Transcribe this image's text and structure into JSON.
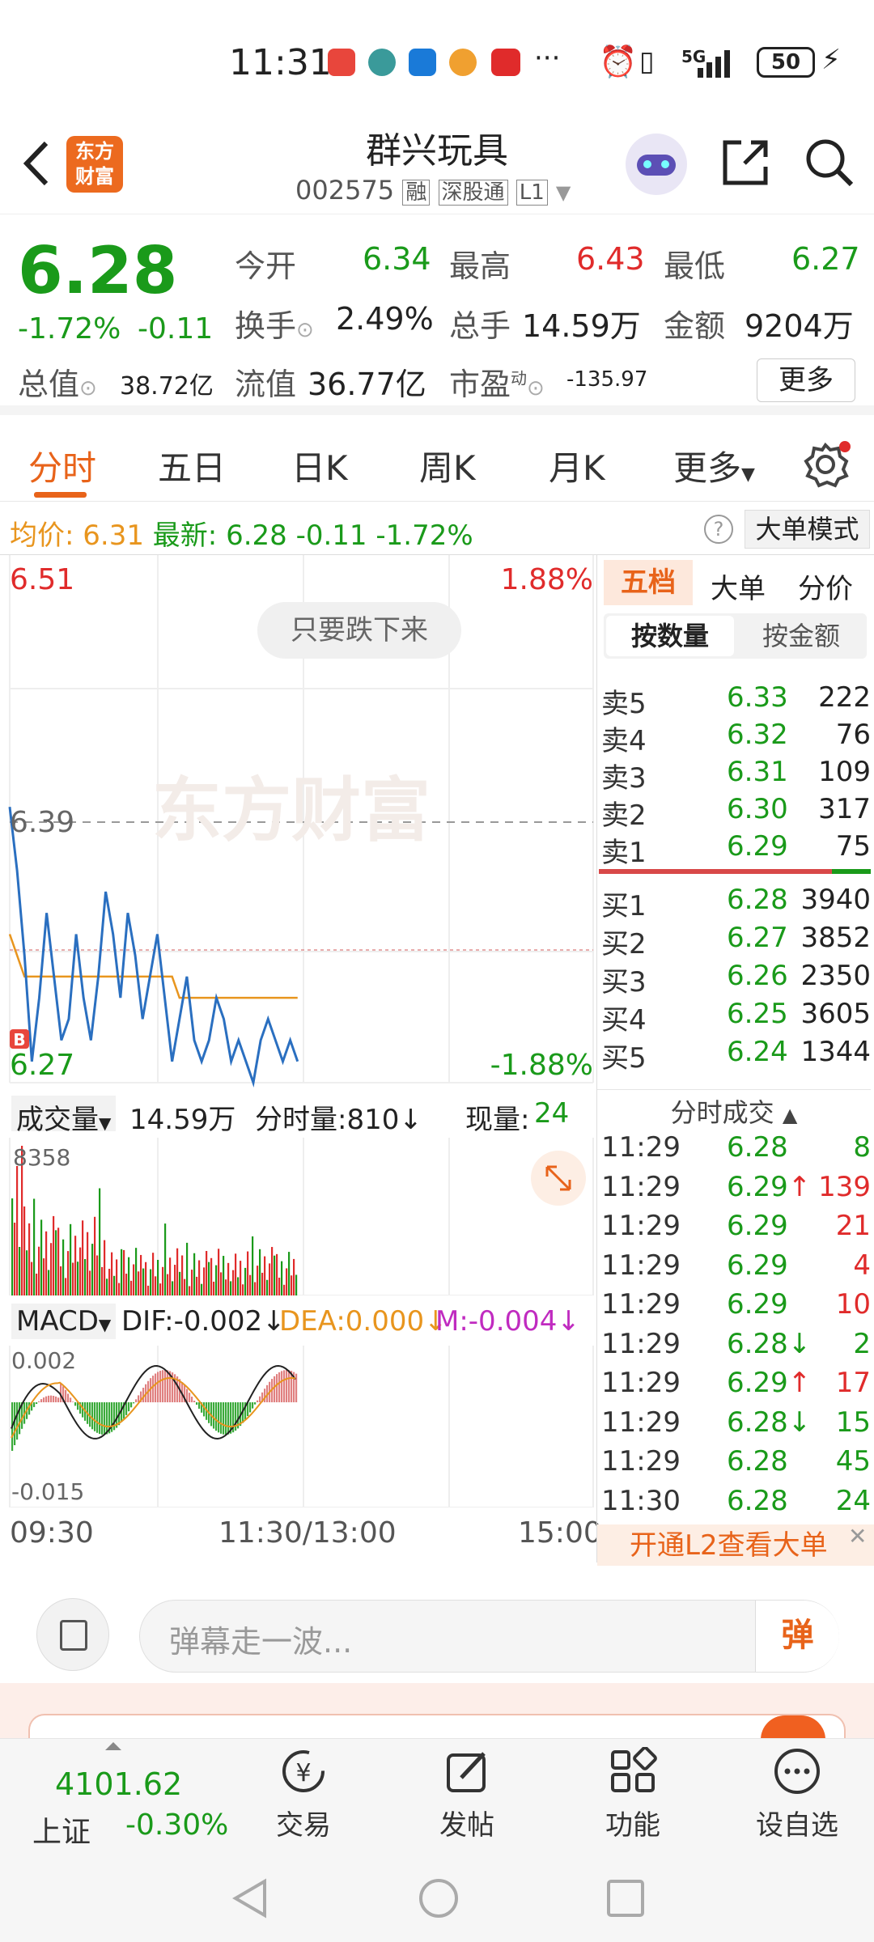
{
  "status": {
    "time": "11:31",
    "network": "5G",
    "battery": "50"
  },
  "header": {
    "title": "群兴玩具",
    "code": "002575",
    "tag_rong": "融",
    "tag_sgt": "深股通",
    "tag_l1": "L1",
    "logo_line1": "东方",
    "logo_line2": "财富"
  },
  "quote": {
    "price": "6.28",
    "change_pct": "-1.72%",
    "change": "-0.11",
    "open_label": "今开",
    "open": "6.34",
    "high_label": "最高",
    "high": "6.43",
    "low_label": "最低",
    "low": "6.27",
    "turnover_label": "换手",
    "turnover": "2.49%",
    "volume_label": "总手",
    "volume": "14.59万",
    "amount_label": "金额",
    "amount": "9204万",
    "mktcap_label": "总值",
    "mktcap": "38.72亿",
    "float_label": "流值",
    "float_cap": "36.77亿",
    "pe_label": "市盈",
    "pe_sup": "动",
    "pe": "-135.97",
    "more": "更多"
  },
  "tabs": [
    "分时",
    "五日",
    "日K",
    "周K",
    "月K",
    "更多"
  ],
  "info_line": {
    "avg_label": "均价:",
    "avg": "6.31",
    "latest_label": "最新:",
    "latest": "6.28",
    "chg": "-0.11",
    "pct": "-1.72%",
    "mode": "大单模式"
  },
  "chart": {
    "y_top": "6.51",
    "pct_top": "1.88%",
    "y_mid": "6.39",
    "y_bot": "6.27",
    "pct_bot": "-1.88%",
    "bubble": "只要跌下来",
    "watermark": "东方财富",
    "b_marker": "B",
    "vol_label": "成交量",
    "vol_total": "14.59万",
    "fs_label": "分时量:810↓",
    "now_label": "现量:",
    "now_val": "24",
    "vol_max": "8358",
    "macd_label": "MACD",
    "dif": "DIF:-0.002↓",
    "dea": "DEA:0.000↓",
    "m": "M:-0.004↓",
    "macd_top": "0.002",
    "macd_bot": "-0.015",
    "x_start": "09:30",
    "x_mid": "11:30/13:00",
    "x_end": "15:00"
  },
  "chart_data": {
    "type": "line",
    "price_series": [
      6.4,
      6.37,
      6.33,
      6.28,
      6.31,
      6.35,
      6.32,
      6.29,
      6.3,
      6.34,
      6.31,
      6.29,
      6.32,
      6.36,
      6.34,
      6.31,
      6.35,
      6.33,
      6.3,
      6.32,
      6.34,
      6.31,
      6.28,
      6.3,
      6.32,
      6.29,
      6.28,
      6.29,
      6.31,
      6.3,
      6.28,
      6.29,
      6.28,
      6.27,
      6.29,
      6.3,
      6.29,
      6.28,
      6.29,
      6.28
    ],
    "avg_series": [
      6.34,
      6.33,
      6.32,
      6.32,
      6.32,
      6.32,
      6.32,
      6.32,
      6.32,
      6.32,
      6.32,
      6.32,
      6.32,
      6.32,
      6.32,
      6.32,
      6.32,
      6.32,
      6.32,
      6.32,
      6.32,
      6.32,
      6.32,
      6.31,
      6.31,
      6.31,
      6.31,
      6.31,
      6.31,
      6.31,
      6.31,
      6.31,
      6.31,
      6.31,
      6.31,
      6.31,
      6.31,
      6.31,
      6.31,
      6.31
    ],
    "prev_close": 6.39,
    "ylim": [
      6.27,
      6.51
    ]
  },
  "orderbook": {
    "tab1": "五档",
    "tab2": "大单",
    "tab3": "分价",
    "sub1": "按数量",
    "sub2": "按金额",
    "sells": [
      {
        "l": "卖5",
        "p": "6.33",
        "v": "222"
      },
      {
        "l": "卖4",
        "p": "6.32",
        "v": "76"
      },
      {
        "l": "卖3",
        "p": "6.31",
        "v": "109"
      },
      {
        "l": "卖2",
        "p": "6.30",
        "v": "317"
      },
      {
        "l": "卖1",
        "p": "6.29",
        "v": "75"
      }
    ],
    "buys": [
      {
        "l": "买1",
        "p": "6.28",
        "v": "3940"
      },
      {
        "l": "买2",
        "p": "6.27",
        "v": "3852"
      },
      {
        "l": "买3",
        "p": "6.26",
        "v": "2350"
      },
      {
        "l": "买4",
        "p": "6.25",
        "v": "3605"
      },
      {
        "l": "买5",
        "p": "6.24",
        "v": "1344"
      }
    ],
    "trades_title": "分时成交",
    "trades": [
      {
        "t": "11:29",
        "p": "6.28",
        "v": "8",
        "vc": "green"
      },
      {
        "t": "11:29",
        "p": "6.29↑",
        "v": "139",
        "vc": "red"
      },
      {
        "t": "11:29",
        "p": "6.29",
        "v": "21",
        "vc": "red"
      },
      {
        "t": "11:29",
        "p": "6.29",
        "v": "4",
        "vc": "red"
      },
      {
        "t": "11:29",
        "p": "6.29",
        "v": "10",
        "vc": "red"
      },
      {
        "t": "11:29",
        "p": "6.28↓",
        "v": "2",
        "vc": "green"
      },
      {
        "t": "11:29",
        "p": "6.29↑",
        "v": "17",
        "vc": "red"
      },
      {
        "t": "11:29",
        "p": "6.28↓",
        "v": "15",
        "vc": "green"
      },
      {
        "t": "11:29",
        "p": "6.28",
        "v": "45",
        "vc": "green"
      },
      {
        "t": "11:30",
        "p": "6.28",
        "v": "24",
        "vc": "green"
      }
    ],
    "l2_banner": "开通L2查看大单"
  },
  "comment": {
    "placeholder": "弹幕走一波...",
    "send": "弹"
  },
  "bottom": {
    "index_value": "4101.62",
    "index_name": "上证",
    "index_pct": "-0.30%",
    "trade": "交易",
    "post": "发帖",
    "func": "功能",
    "watch": "设自选"
  }
}
